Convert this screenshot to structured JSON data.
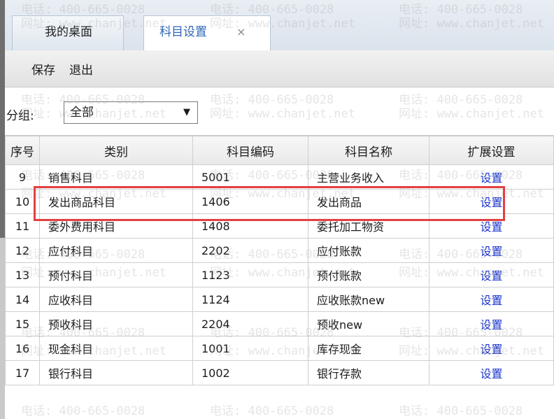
{
  "tabs": {
    "desktop_label": "我的桌面",
    "settings_label": "科目设置",
    "close_glyph": "×"
  },
  "toolbar": {
    "save_label": "保存",
    "exit_label": "退出"
  },
  "group": {
    "label": "分组:",
    "selected": "全部",
    "caret": "▼"
  },
  "table": {
    "headers": {
      "seq": "序号",
      "category": "类别",
      "code": "科目编码",
      "name": "科目名称",
      "extension": "扩展设置"
    },
    "rows": [
      {
        "seq": "9",
        "category": "销售科目",
        "code": "5001",
        "name": "主营业务收入",
        "action": "设置"
      },
      {
        "seq": "10",
        "category": "发出商品科目",
        "code": "1406",
        "name": "发出商品",
        "action": "设置"
      },
      {
        "seq": "11",
        "category": "委外费用科目",
        "code": "1408",
        "name": "委托加工物资",
        "action": "设置"
      },
      {
        "seq": "12",
        "category": "应付科目",
        "code": "2202",
        "name": "应付账款",
        "action": "设置"
      },
      {
        "seq": "13",
        "category": "预付科目",
        "code": "1123",
        "name": "预付账款",
        "action": "设置"
      },
      {
        "seq": "14",
        "category": "应收科目",
        "code": "1124",
        "name": "应收账款new",
        "action": "设置"
      },
      {
        "seq": "15",
        "category": "预收科目",
        "code": "2204",
        "name": "预收new",
        "action": "设置"
      },
      {
        "seq": "16",
        "category": "现金科目",
        "code": "1001",
        "name": "库存现金",
        "action": "设置"
      },
      {
        "seq": "17",
        "category": "银行科目",
        "code": "1002",
        "name": "银行存款",
        "action": "设置"
      }
    ]
  },
  "watermark": {
    "phone": "电话: 400-665-0028",
    "site": "网址: www.chanjet.net"
  },
  "colors": {
    "link": "#1a33cc",
    "active_tab_text": "#2f67b5",
    "highlight": "#e34040"
  }
}
